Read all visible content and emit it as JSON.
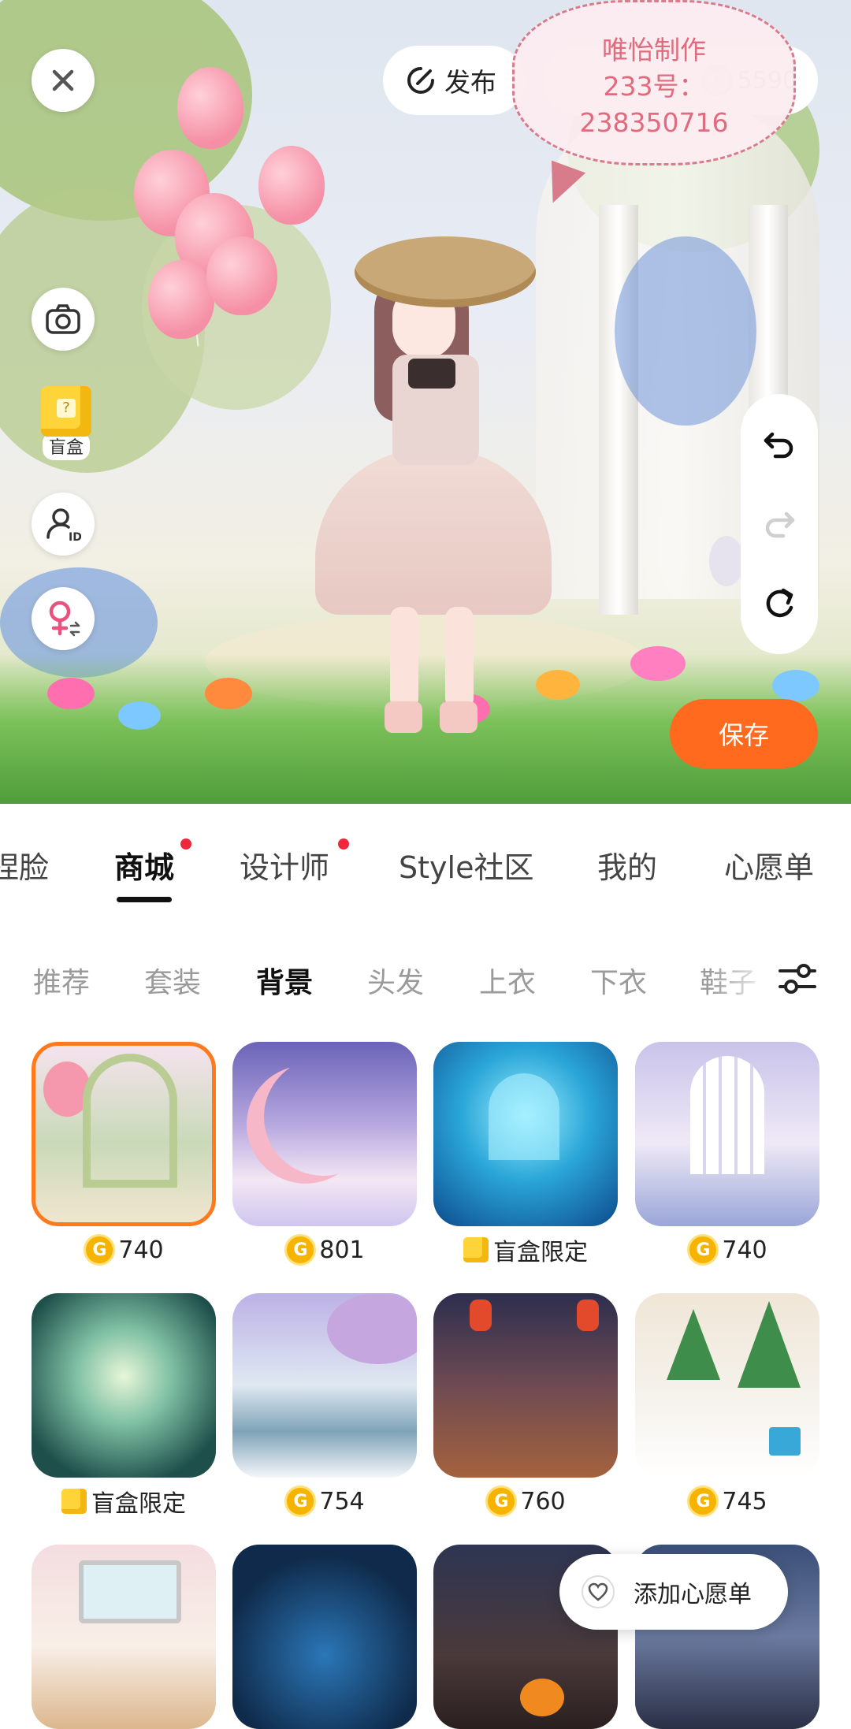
{
  "scene": {
    "publish_label": "发布",
    "coin_balance": "5590",
    "watermark_lines": [
      "唯怡制作",
      "233号：",
      "238350716"
    ],
    "blindbox_label": "盲盒",
    "save_label": "保存"
  },
  "main_tabs": [
    {
      "label": "捏脸",
      "active": false,
      "dot": false
    },
    {
      "label": "商城",
      "active": true,
      "dot": true
    },
    {
      "label": "设计师",
      "active": false,
      "dot": true
    },
    {
      "label": "Style社区",
      "active": false,
      "dot": false
    },
    {
      "label": "我的",
      "active": false,
      "dot": false
    },
    {
      "label": "心愿单",
      "active": false,
      "dot": false
    }
  ],
  "sub_tabs": [
    {
      "label": "推荐",
      "active": false
    },
    {
      "label": "套装",
      "active": false
    },
    {
      "label": "背景",
      "active": true
    },
    {
      "label": "头发",
      "active": false
    },
    {
      "label": "上衣",
      "active": false
    },
    {
      "label": "下衣",
      "active": false
    },
    {
      "label": "鞋子",
      "active": false
    }
  ],
  "items": [
    {
      "price": "740",
      "type": "coin",
      "selected": true,
      "theme": "garden"
    },
    {
      "price": "801",
      "type": "coin",
      "selected": false,
      "theme": "moon"
    },
    {
      "price": "盲盒限定",
      "type": "blindbox",
      "selected": false,
      "theme": "ocean"
    },
    {
      "price": "740",
      "type": "coin",
      "selected": false,
      "theme": "hall"
    },
    {
      "price": "盲盒限定",
      "type": "blindbox",
      "selected": false,
      "theme": "mist"
    },
    {
      "price": "754",
      "type": "coin",
      "selected": false,
      "theme": "blossom"
    },
    {
      "price": "760",
      "type": "coin",
      "selected": false,
      "theme": "lantern"
    },
    {
      "price": "745",
      "type": "coin",
      "selected": false,
      "theme": "christmas"
    },
    {
      "price": "",
      "type": "coin",
      "selected": false,
      "theme": "room"
    },
    {
      "price": "",
      "type": "coin",
      "selected": false,
      "theme": "night-forest"
    },
    {
      "price": "",
      "type": "coin",
      "selected": false,
      "theme": "halloween"
    },
    {
      "price": "",
      "type": "coin",
      "selected": false,
      "theme": "dusk-house"
    }
  ],
  "wishlist_tip": "添加心愿单",
  "colors": {
    "accent": "#ff6a1f",
    "coin": "#f6b400",
    "badge": "#f0263a"
  }
}
